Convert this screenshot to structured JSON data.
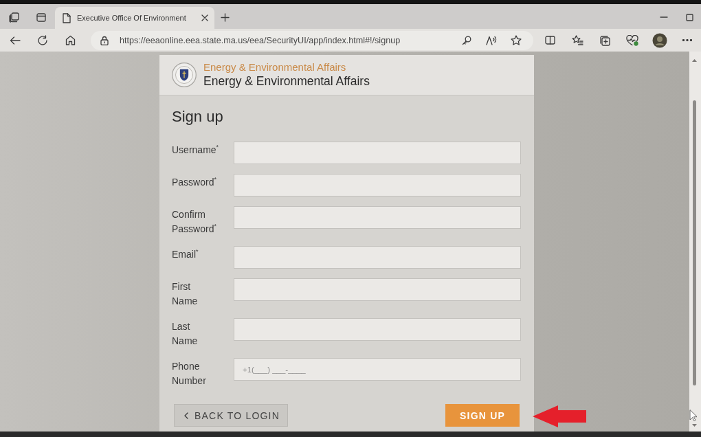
{
  "browser": {
    "tabs": [
      {
        "title": "Executive Office Of Environment",
        "selected": true
      }
    ],
    "address_bar": {
      "url": "https://eeaonline.eea.state.ma.us/eea/SecurityUI/app/index.html#!/signup"
    }
  },
  "header": {
    "org_name": "Energy & Environmental Affairs",
    "app_name": "Energy & Environmental Affairs"
  },
  "form": {
    "title": "Sign up",
    "fields": [
      {
        "label": "Username$^{*}$"
      },
      {
        "label": "Password$^{*}$"
      },
      {
        "label": "Confirm Password$^{*}$"
      },
      {
        "label": "Email$^{*}$"
      },
      {
        "label": "First Name"
      },
      {
        "label": "Last Name"
      },
      {
        "label": "Phone Number",
        "placeholder": "+1(___) ___-____"
      }
    ],
    "buttons": [
      {
        "label": "BACK TO LOGIN",
        "kind": "secondary"
      },
      {
        "label": "SIGN UP",
        "kind": "primary"
      }
    ]
  }
}
